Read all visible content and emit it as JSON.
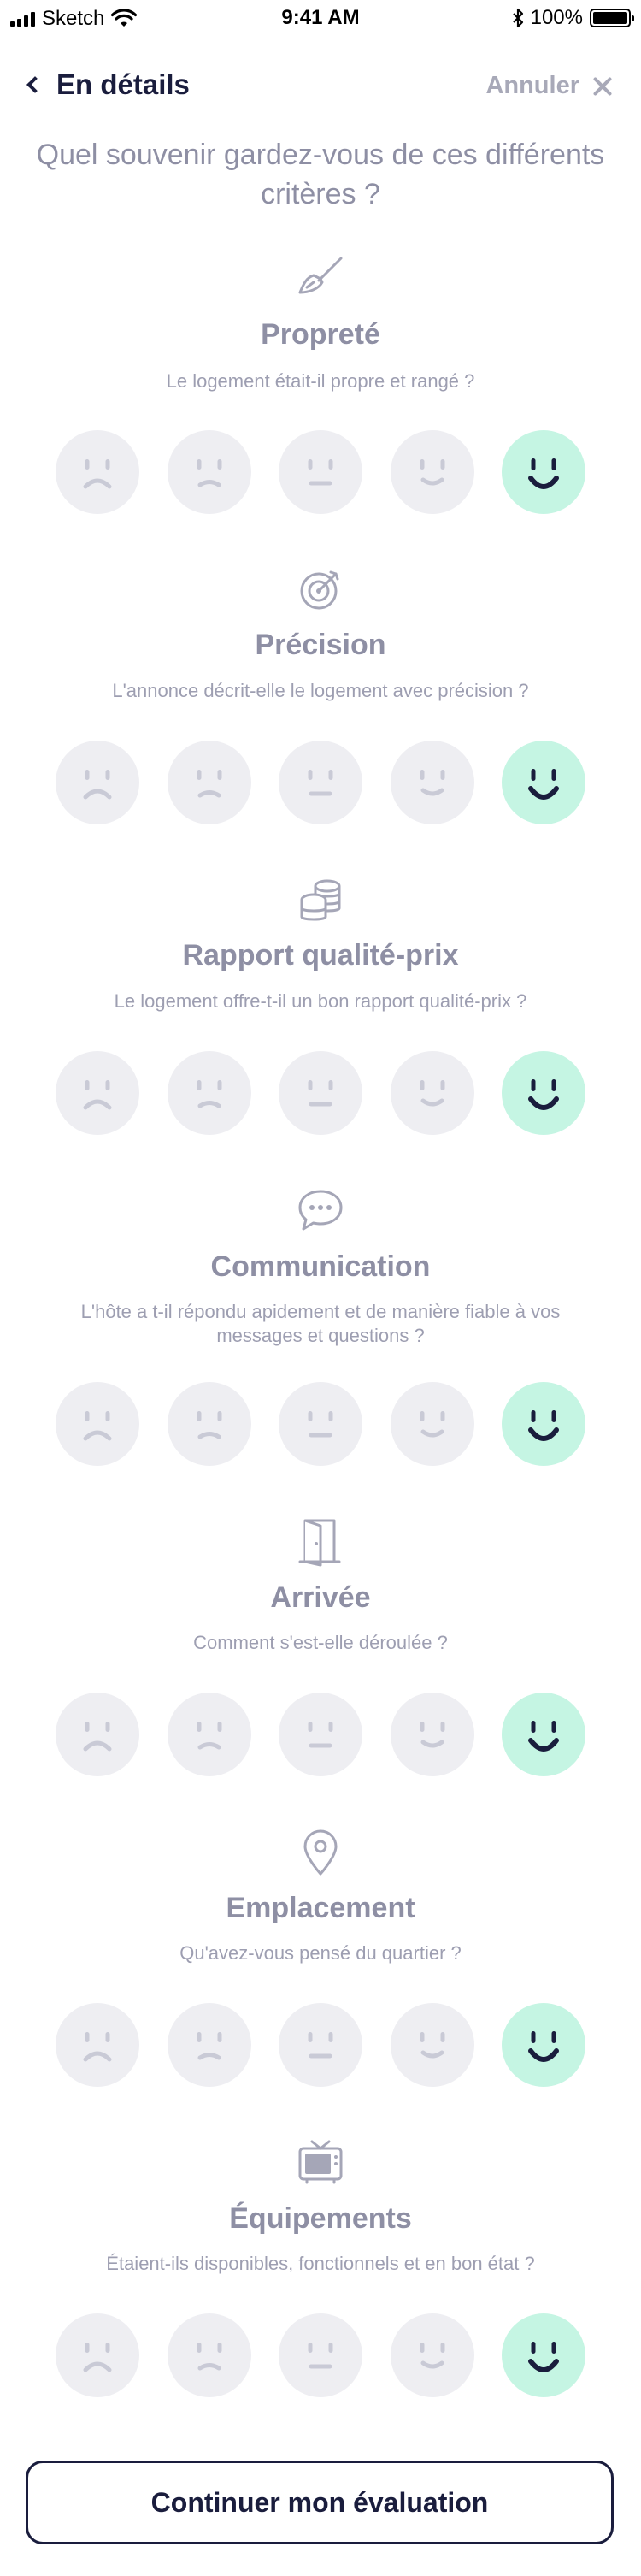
{
  "status_bar": {
    "carrier": "Sketch",
    "time": "9:41 AM",
    "battery": "100%"
  },
  "nav": {
    "back_label": "En détails",
    "cancel_label": "Annuler"
  },
  "question": "Quel souvenir gardez-vous de ces différents critères ?",
  "criteria": [
    {
      "icon": "brush-icon",
      "title": "Propreté",
      "subtitle": "Le logement était-il propre et rangé ?",
      "rating": 5
    },
    {
      "icon": "target-icon",
      "title": "Précision",
      "subtitle": "L'annonce décrit-elle le logement avec précision ?",
      "rating": 5
    },
    {
      "icon": "coins-icon",
      "title": "Rapport qualité-prix",
      "subtitle": "Le logement offre-t-il un bon rapport qualité-prix ?",
      "rating": 5
    },
    {
      "icon": "chat-bubble-icon",
      "title": "Communication",
      "subtitle": "L'hôte a t-il répondu apidement et de manière fiable à vos messages et questions ?",
      "rating": 5
    },
    {
      "icon": "door-icon",
      "title": "Arrivée",
      "subtitle": "Comment s'est-elle déroulée ?",
      "rating": 5
    },
    {
      "icon": "map-pin-icon",
      "title": "Emplacement",
      "subtitle": "Qu'avez-vous pensé du quartier ?",
      "rating": 5
    },
    {
      "icon": "tv-icon",
      "title": "Équipements",
      "subtitle": "Étaient-ils disponibles, fonctionnels et en bon état ?",
      "rating": 5
    }
  ],
  "rating_scale": [
    "very-sad-face-icon",
    "sad-face-icon",
    "neutral-face-icon",
    "smile-face-icon",
    "big-smile-face-icon"
  ],
  "colors": {
    "accent": "#c5f5e3",
    "primary": "#1a1d3d",
    "muted": "#8e8fa4",
    "face_bg": "#eeeef2",
    "face_stroke": "#c9cad6"
  },
  "continue_label": "Continuer mon évaluation"
}
